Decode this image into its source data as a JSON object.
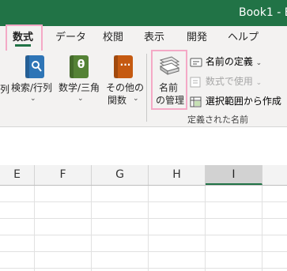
{
  "window": {
    "title": "Book1 - E"
  },
  "tabs": [
    {
      "label": "数式",
      "active": true
    },
    {
      "label": "データ"
    },
    {
      "label": "校閲"
    },
    {
      "label": "表示"
    },
    {
      "label": "開発"
    },
    {
      "label": "ヘルプ"
    }
  ],
  "ribbon": {
    "cut_left_label": "列",
    "lookup": {
      "label": "検索/行列",
      "icon": "lookup-book-icon",
      "color": "#2e75b6"
    },
    "math": {
      "label": "数学/三角",
      "icon": "math-book-icon",
      "color": "#548235"
    },
    "more": {
      "label1": "その他の",
      "label2": "関数",
      "icon": "more-functions-book-icon",
      "color": "#c55a11"
    },
    "name_manager": {
      "label1": "名前",
      "label2": "の管理",
      "icon": "name-manager-icon"
    },
    "define_name": {
      "label": "名前の定義",
      "icon": "define-name-icon"
    },
    "use_in_formula": {
      "label": "数式で使用",
      "icon": "use-in-formula-icon"
    },
    "create_from_selection": {
      "label": "選択範囲から作成",
      "icon": "create-from-selection-icon"
    },
    "group_label": "定義された名前"
  },
  "columns": [
    {
      "label": "E"
    },
    {
      "label": "F"
    },
    {
      "label": "G"
    },
    {
      "label": "H"
    },
    {
      "label": "I",
      "selected": true
    }
  ],
  "colors": {
    "accent": "#217346",
    "highlight": "#f4a9c6"
  }
}
